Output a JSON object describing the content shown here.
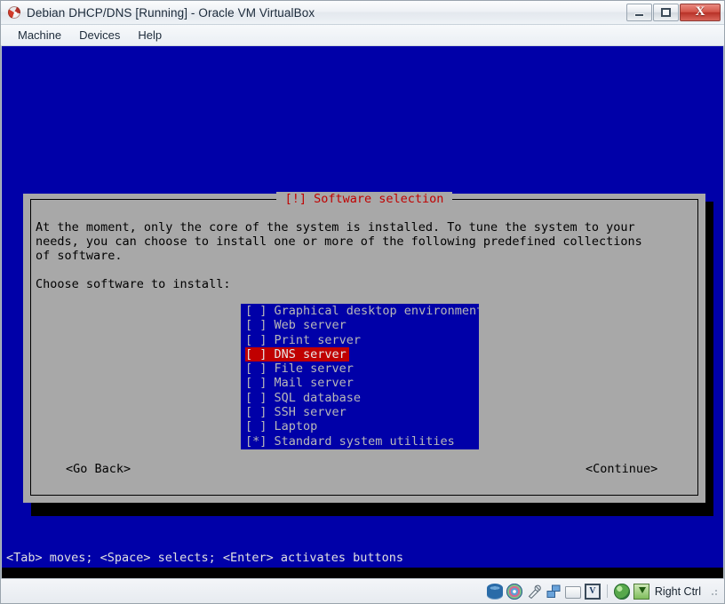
{
  "window": {
    "title": "Debian DHCP/DNS [Running] - Oracle VM VirtualBox",
    "icon": "virtualbox-icon",
    "ghost_text": "",
    "buttons": {
      "minimize": "minimize-button",
      "maximize": "maximize-button",
      "close_glyph": "X"
    }
  },
  "menubar": {
    "items": [
      {
        "label": "Machine"
      },
      {
        "label": "Devices"
      },
      {
        "label": "Help"
      }
    ]
  },
  "installer": {
    "dialog_title": "[!] Software selection",
    "body_text": "At the moment, only the core of the system is installed. To tune the system to your needs, you can choose to install one or more of the following predefined collections of software.",
    "prompt": "Choose software to install:",
    "items": [
      {
        "checkbox": "[ ]",
        "label": "Graphical desktop environment",
        "selected": false
      },
      {
        "checkbox": "[ ]",
        "label": "Web server",
        "selected": false
      },
      {
        "checkbox": "[ ]",
        "label": "Print server",
        "selected": false
      },
      {
        "checkbox": "[ ]",
        "label": "DNS server",
        "selected": true
      },
      {
        "checkbox": "[ ]",
        "label": "File server",
        "selected": false
      },
      {
        "checkbox": "[ ]",
        "label": "Mail server",
        "selected": false
      },
      {
        "checkbox": "[ ]",
        "label": "SQL database",
        "selected": false
      },
      {
        "checkbox": "[ ]",
        "label": "SSH server",
        "selected": false
      },
      {
        "checkbox": "[ ]",
        "label": "Laptop",
        "selected": false
      },
      {
        "checkbox": "[*]",
        "label": "Standard system utilities",
        "selected": false
      }
    ],
    "go_back_label": "<Go Back>",
    "continue_label": "<Continue>",
    "help_line": "<Tab> moves; <Space> selects; <Enter> activates buttons",
    "colors": {
      "screen_blue": "#0000a8",
      "dialog_gray": "#a8a8a8",
      "title_red": "#c00000",
      "highlight_red": "#c00000"
    }
  },
  "statusbar": {
    "icons": [
      {
        "name": "hard-disk-icon"
      },
      {
        "name": "optical-disk-icon"
      },
      {
        "name": "usb-icon"
      },
      {
        "name": "network-icon"
      },
      {
        "name": "shared-folders-icon"
      },
      {
        "name": "display-capture-icon"
      }
    ],
    "right_icons": [
      {
        "name": "remote-desktop-globe-icon"
      },
      {
        "name": "host-key-icon"
      }
    ],
    "host_key_label": "Right Ctrl"
  }
}
